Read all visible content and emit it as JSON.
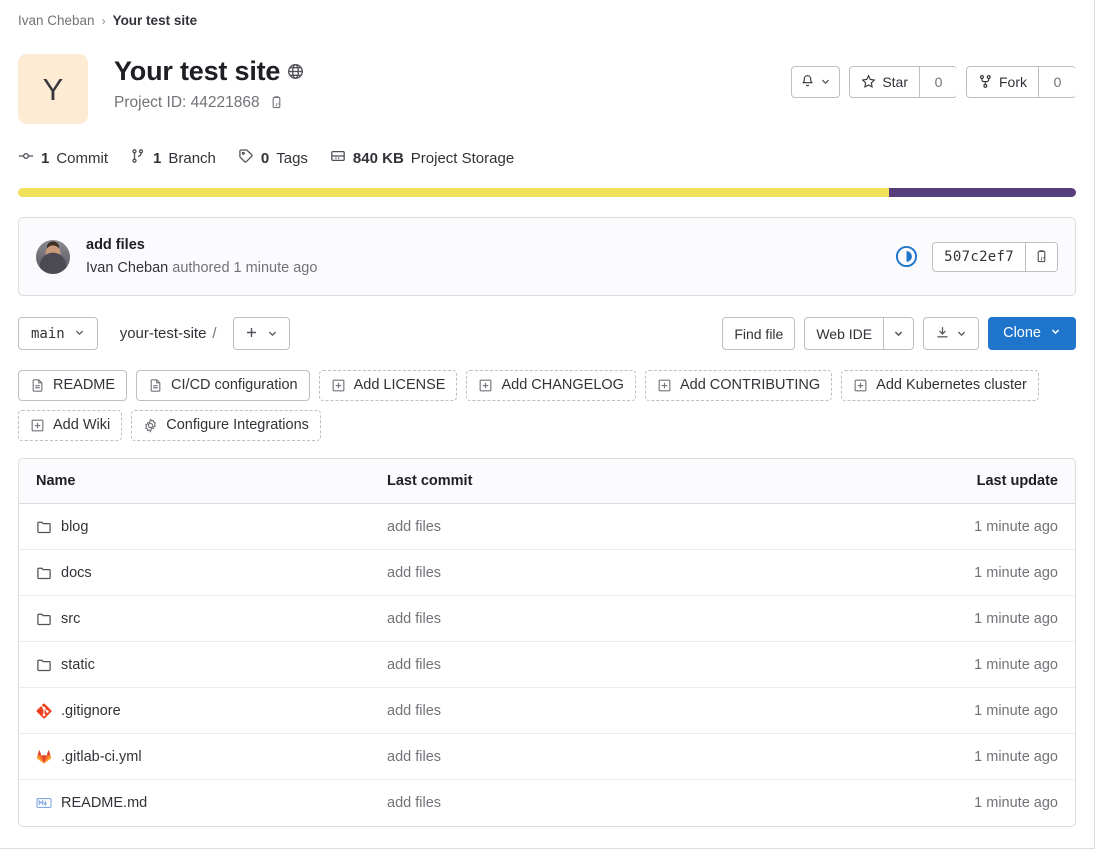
{
  "breadcrumb": {
    "owner": "Ivan Cheban",
    "separator": "›",
    "current": "Your test site"
  },
  "project": {
    "avatar_letter": "Y",
    "avatar_bg": "#fdebd4",
    "title": "Your test site",
    "visibility_icon": "globe-icon",
    "project_id_label": "Project ID: 44221868",
    "copy_icon": "copy-to-clipboard-icon"
  },
  "header_actions": {
    "notification_icon": "bell-icon",
    "notification_caret": "chevron-down-icon",
    "star_label": "Star",
    "star_count": "0",
    "star_icon": "star-icon",
    "fork_label": "Fork",
    "fork_count": "0",
    "fork_icon": "fork-icon"
  },
  "stats": [
    {
      "icon": "commit-icon",
      "num": "1",
      "label": "Commit"
    },
    {
      "icon": "branch-icon",
      "num": "1",
      "label": "Branch"
    },
    {
      "icon": "tag-icon",
      "num": "0",
      "label": "Tags"
    },
    {
      "icon": "storage-icon",
      "num": "840 KB",
      "label": "Project Storage"
    }
  ],
  "language_bar": [
    {
      "name": "primary",
      "color": "#f1e05a",
      "percent": 82.3
    },
    {
      "name": "secondary",
      "color": "#563d7c",
      "percent": 17.7
    }
  ],
  "last_commit": {
    "avatar": "user-avatar-photo",
    "title": "add files",
    "author": "Ivan Cheban",
    "action": "authored",
    "time": "1 minute ago",
    "pipeline_status": "pipeline-running-icon",
    "pipeline_color": "#1f75cb",
    "sha": "507c2ef7",
    "copy_icon": "copy-to-clipboard-icon"
  },
  "branch_bar": {
    "branch": "main",
    "branch_caret": "chevron-down-icon",
    "path_root": "your-test-site",
    "path_separator": "/",
    "add_icon": "plus-icon",
    "add_caret": "chevron-down-icon",
    "find_file": "Find file",
    "web_ide": "Web IDE",
    "web_ide_caret": "chevron-down-icon",
    "download_icon": "download-icon",
    "download_caret": "chevron-down-icon",
    "clone": "Clone",
    "clone_caret": "chevron-down-icon",
    "clone_color": "#1f75cb"
  },
  "quick_actions": [
    {
      "label": "README",
      "icon": "doc-icon",
      "dashed": false
    },
    {
      "label": "CI/CD configuration",
      "icon": "doc-icon",
      "dashed": false
    },
    {
      "label": "Add LICENSE",
      "icon": "plus-square-icon",
      "dashed": true
    },
    {
      "label": "Add CHANGELOG",
      "icon": "plus-square-icon",
      "dashed": true
    },
    {
      "label": "Add CONTRIBUTING",
      "icon": "plus-square-icon",
      "dashed": true
    },
    {
      "label": "Add Kubernetes cluster",
      "icon": "plus-square-icon",
      "dashed": true
    },
    {
      "label": "Add Wiki",
      "icon": "plus-square-icon",
      "dashed": true
    },
    {
      "label": "Configure Integrations",
      "icon": "gear-icon",
      "dashed": true
    }
  ],
  "tree": {
    "columns": {
      "name": "Name",
      "last_commit": "Last commit",
      "last_update": "Last update"
    },
    "rows": [
      {
        "name": "blog",
        "icon": "folder-icon",
        "commit": "add files",
        "update": "1 minute ago"
      },
      {
        "name": "docs",
        "icon": "folder-icon",
        "commit": "add files",
        "update": "1 minute ago"
      },
      {
        "name": "src",
        "icon": "folder-icon",
        "commit": "add files",
        "update": "1 minute ago"
      },
      {
        "name": "static",
        "icon": "folder-icon",
        "commit": "add files",
        "update": "1 minute ago"
      },
      {
        "name": ".gitignore",
        "icon": "git-file-icon",
        "commit": "add files",
        "update": "1 minute ago"
      },
      {
        "name": ".gitlab-ci.yml",
        "icon": "gitlab-icon",
        "commit": "add files",
        "update": "1 minute ago"
      },
      {
        "name": "README.md",
        "icon": "markdown-icon",
        "commit": "add files",
        "update": "1 minute ago"
      }
    ]
  }
}
